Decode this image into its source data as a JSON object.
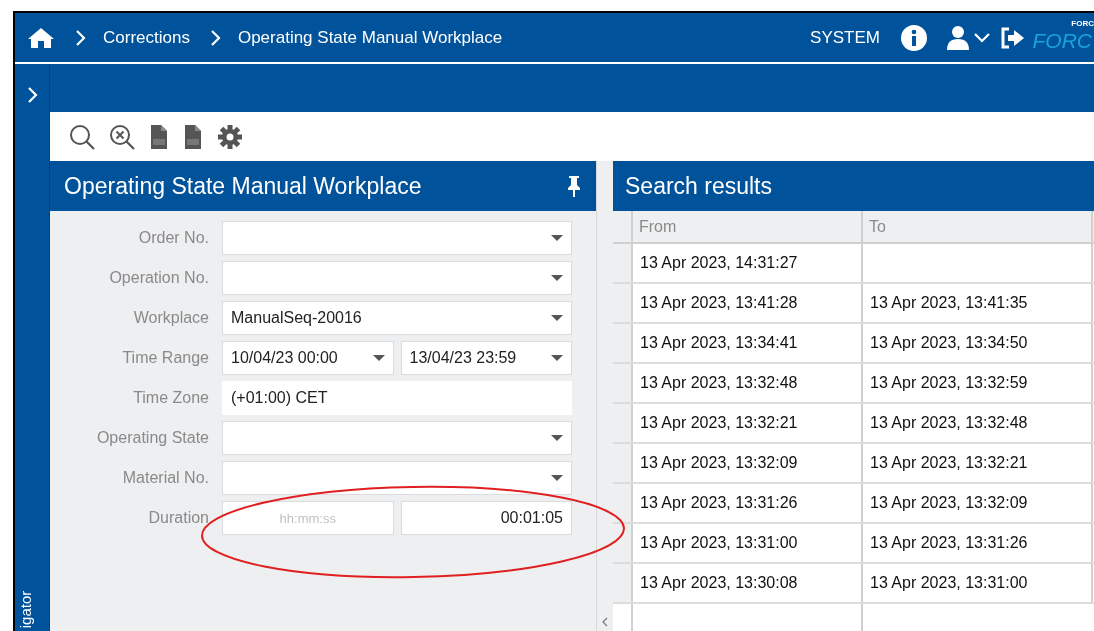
{
  "header": {
    "breadcrumbs": [
      "Corrections",
      "Operating State Manual Workplace"
    ],
    "user_label": "SYSTEM",
    "logo_small": "FORC",
    "logo_large": "FORC"
  },
  "navigator": {
    "label": "igator",
    "expanded": false
  },
  "toolbar": [
    {
      "kind": "search"
    },
    {
      "kind": "clear-search"
    },
    {
      "kind": "pdf"
    },
    {
      "kind": "csv"
    },
    {
      "kind": "settings"
    }
  ],
  "filter_panel": {
    "title": "Operating State Manual Workplace",
    "pinned": true,
    "fields": [
      {
        "label": "Order No.",
        "kind": "dropdown"
      },
      {
        "label": "Operation No.",
        "kind": "dropdown"
      },
      {
        "label": "Workplace",
        "kind": "dropdown",
        "inputs": [
          {
            "value": "ManualSeq-20016"
          }
        ]
      },
      {
        "label": "Time Range",
        "kind": "dropdown",
        "inputs": [
          {
            "value": "10/04/23 00:00"
          },
          {
            "value": "13/04/23 23:59"
          }
        ]
      },
      {
        "label": "Time Zone",
        "kind": "text",
        "inputs": [
          {
            "value": "(+01:00) CET"
          }
        ]
      },
      {
        "label": "Operating State",
        "kind": "dropdown"
      },
      {
        "label": "Material No.",
        "kind": "dropdown"
      },
      {
        "label": "Duration",
        "kind": "range",
        "inputs": [
          {
            "placeholder": "hh:mm:ss"
          },
          {
            "value": "00:01:05"
          }
        ]
      }
    ]
  },
  "annotations": [
    {
      "kind": "ellipse",
      "color": "#e02020"
    }
  ],
  "results": {
    "title": "Search results",
    "columns": [
      "From",
      "To"
    ],
    "rows": [
      [
        "13 Apr 2023, 14:31:27",
        null
      ],
      [
        "13 Apr 2023, 13:41:28",
        "13 Apr 2023, 13:41:35"
      ],
      [
        "13 Apr 2023, 13:34:41",
        "13 Apr 2023, 13:34:50"
      ],
      [
        "13 Apr 2023, 13:32:48",
        "13 Apr 2023, 13:32:59"
      ],
      [
        "13 Apr 2023, 13:32:21",
        "13 Apr 2023, 13:32:48"
      ],
      [
        "13 Apr 2023, 13:32:09",
        "13 Apr 2023, 13:32:21"
      ],
      [
        "13 Apr 2023, 13:31:26",
        "13 Apr 2023, 13:32:09"
      ],
      [
        "13 Apr 2023, 13:31:00",
        "13 Apr 2023, 13:31:26"
      ],
      [
        "13 Apr 2023, 13:30:08",
        "13 Apr 2023, 13:31:00"
      ]
    ]
  }
}
